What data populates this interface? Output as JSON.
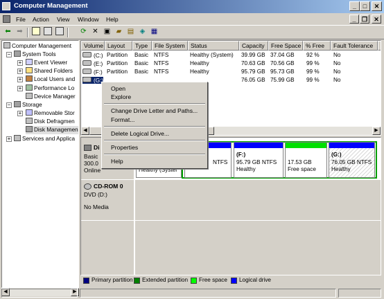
{
  "window": {
    "title": "Computer Management"
  },
  "menu": [
    "File",
    "Action",
    "View",
    "Window",
    "Help"
  ],
  "tree": [
    {
      "label": "Computer Management",
      "icon": "computer-icon"
    },
    {
      "label": "System Tools",
      "icon": "tools-icon"
    },
    {
      "label": "Event Viewer",
      "icon": "event-viewer-icon"
    },
    {
      "label": "Shared Folders",
      "icon": "folder-icon"
    },
    {
      "label": "Local Users and",
      "icon": "users-icon"
    },
    {
      "label": "Performance Lo",
      "icon": "performance-icon"
    },
    {
      "label": "Device Manager",
      "icon": "device-manager-icon"
    },
    {
      "label": "Storage",
      "icon": "storage-icon"
    },
    {
      "label": "Removable Stor",
      "icon": "removable-storage-icon"
    },
    {
      "label": "Disk Defragmen",
      "icon": "defrag-icon"
    },
    {
      "label": "Disk Managemen",
      "icon": "disk-management-icon"
    },
    {
      "label": "Services and Applica",
      "icon": "services-icon"
    }
  ],
  "columns": [
    "Volume",
    "Layout",
    "Type",
    "File System",
    "Status",
    "Capacity",
    "Free Space",
    "% Free",
    "Fault Tolerance",
    "O"
  ],
  "volumes": [
    {
      "volume": "(C:)",
      "layout": "Partition",
      "type": "Basic",
      "fs": "NTFS",
      "status": "Healthy (System)",
      "capacity": "39.99 GB",
      "free": "37.04 GB",
      "pct": "92 %",
      "ft": "No"
    },
    {
      "volume": "(E:)",
      "layout": "Partition",
      "type": "Basic",
      "fs": "NTFS",
      "status": "Healthy",
      "capacity": "70.63 GB",
      "free": "70.56 GB",
      "pct": "99 %",
      "ft": "No"
    },
    {
      "volume": "(F:)",
      "layout": "Partition",
      "type": "Basic",
      "fs": "NTFS",
      "status": "Healthy",
      "capacity": "95.79 GB",
      "free": "95.73 GB",
      "pct": "99 %",
      "ft": "No"
    },
    {
      "volume": "(G:)",
      "layout": "Partition",
      "type": "Basic",
      "fs": "NTFS",
      "status": "Healthy",
      "capacity": "76.05 GB",
      "free": "75.99 GB",
      "pct": "99 %",
      "ft": "No"
    }
  ],
  "disk0": {
    "name": "Di",
    "type": "Basic",
    "size": "300.0",
    "state": "Online"
  },
  "partitions": [
    {
      "label": "",
      "line2": "Healthy (Syster",
      "color": "#0000ff"
    },
    {
      "label": "",
      "line2": "NTFS",
      "color": "#0000ff"
    },
    {
      "label": "(F:)",
      "line1": "95.79 GB NTFS",
      "line2": "Healthy",
      "color": "#0000ff"
    },
    {
      "label": "",
      "line1": "17.53 GB",
      "line2": "Free space",
      "color": "#00ff00"
    },
    {
      "label": "(G:)",
      "line1": "76.05 GB NTFS",
      "line2": "Healthy",
      "color": "#0000ff"
    }
  ],
  "cdrom": {
    "name": "CD-ROM 0",
    "drive": "DVD (D:)",
    "media": "No Media"
  },
  "legend": [
    {
      "label": "Primary partition",
      "color": "#000080"
    },
    {
      "label": "Extended partition",
      "color": "#008000"
    },
    {
      "label": "Free space",
      "color": "#00ff00"
    },
    {
      "label": "Logical drive",
      "color": "#0000ff"
    }
  ],
  "context_menu": [
    "Open",
    "Explore",
    "Change Drive Letter and Paths...",
    "Format...",
    "Delete Logical Drive...",
    "Properties",
    "Help"
  ]
}
